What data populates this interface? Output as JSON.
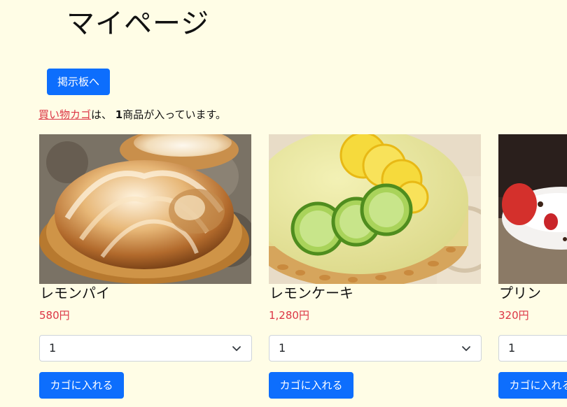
{
  "page": {
    "title": "マイページ"
  },
  "board_button": {
    "label": "掲示板へ"
  },
  "cart": {
    "link_text": "買い物カゴ",
    "text_before_count": "は、 ",
    "count": "1",
    "text_after_count": "商品が入っています。"
  },
  "products": [
    {
      "name": "レモンパイ",
      "price": "580円",
      "quantity": "1",
      "add_label": "カゴに入れる",
      "image": "lemon-meringue-pie-photo"
    },
    {
      "name": "レモンケーキ",
      "price": "1,280円",
      "quantity": "1",
      "add_label": "カゴに入れる",
      "image": "lemon-cake-photo"
    },
    {
      "name": "プリン",
      "price": "320円",
      "quantity": "1",
      "add_label": "カゴに入れる",
      "image": "pudding-photo"
    }
  ],
  "colors": {
    "background": "#fffde6",
    "primary": "#0d6efd",
    "price": "#dc3545",
    "link": "#dc3545"
  }
}
